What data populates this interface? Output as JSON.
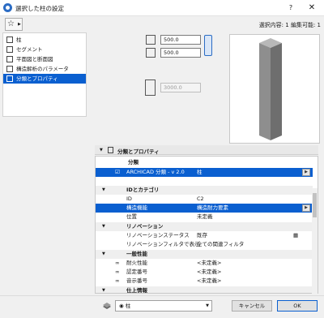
{
  "window": {
    "title": "選択した柱の設定",
    "help": "?",
    "close": "✕"
  },
  "header": {
    "favorites_icon": "☆",
    "selection_info": "選択内容: 1 編集可能: 1"
  },
  "nav": {
    "items": [
      {
        "label": "柱",
        "icon": "column-icon"
      },
      {
        "label": "セグメント",
        "icon": "segment-icon"
      },
      {
        "label": "平面図と断面図",
        "icon": "plan-section-icon"
      },
      {
        "label": "構造解析のパラメータ",
        "icon": "structural-icon"
      },
      {
        "label": "分類とプロパティ",
        "icon": "classification-icon",
        "selected": true
      }
    ]
  },
  "settings": {
    "width": "500.0",
    "depth": "500.0",
    "height": "3000.0"
  },
  "properties": {
    "section_title": "分類とプロパティ",
    "classification": {
      "header": "分類",
      "system": "ARCHICAD 分類 - v 2.0",
      "value": "柱"
    },
    "id_category": {
      "header": "IDとカテゴリ",
      "rows": [
        {
          "label": "ID",
          "value": "C2"
        },
        {
          "label": "構造機能",
          "value": "構造耐力要素"
        },
        {
          "label": "位置",
          "value": "未定義"
        }
      ]
    },
    "renovation": {
      "header": "リノベーション",
      "rows": [
        {
          "label": "リノベーションステータス",
          "value": "既存"
        },
        {
          "label": "リノベーションフィルタで表示",
          "value": "全ての関連フィルタ"
        }
      ]
    },
    "general": {
      "header": "一般性能",
      "rows": [
        {
          "label": "耐火性能",
          "value": "<未定義>"
        },
        {
          "label": "認定番号",
          "value": "<未定義>"
        },
        {
          "label": "音示番号",
          "value": "<未定義>"
        }
      ]
    },
    "next_header": "仕上情報"
  },
  "bottom": {
    "layer": "柱",
    "cancel": "キャンセル",
    "ok": "OK"
  }
}
